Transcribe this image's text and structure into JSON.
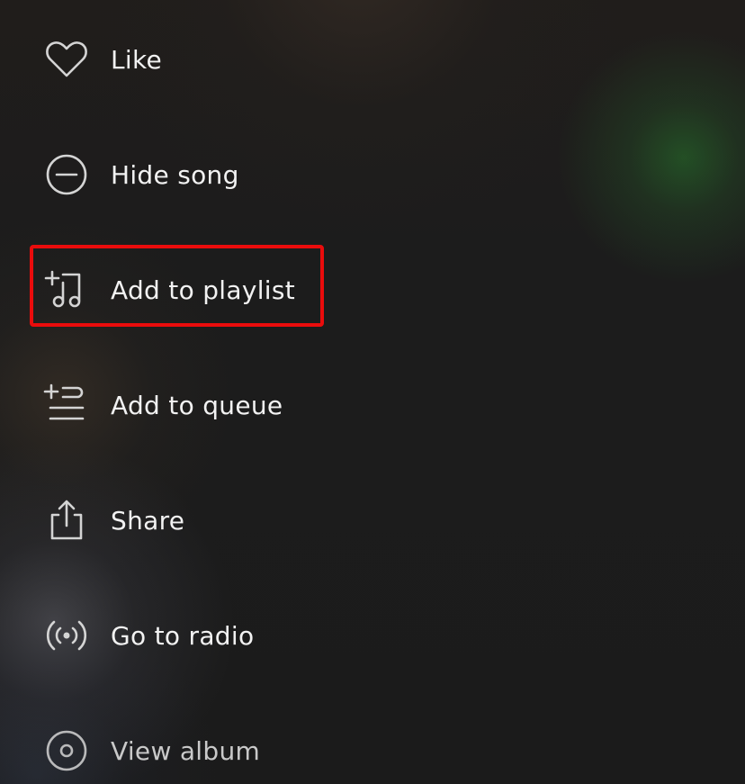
{
  "menu": {
    "items": [
      {
        "label": "Like",
        "icon": "heart-icon"
      },
      {
        "label": "Hide song",
        "icon": "minus-circle-icon"
      },
      {
        "label": "Add to playlist",
        "icon": "add-to-playlist-icon"
      },
      {
        "label": "Add to queue",
        "icon": "add-to-queue-icon"
      },
      {
        "label": "Share",
        "icon": "share-icon"
      },
      {
        "label": "Go to radio",
        "icon": "radio-icon"
      },
      {
        "label": "View album",
        "icon": "album-icon"
      }
    ]
  },
  "highlight": {
    "target": "Add to playlist",
    "color": "#ea0c0c"
  },
  "colors": {
    "background": "#1b1b1b",
    "text": "#f2f2f2",
    "icon": "#d0d0d0",
    "accent_glow": "#2a7a30"
  }
}
